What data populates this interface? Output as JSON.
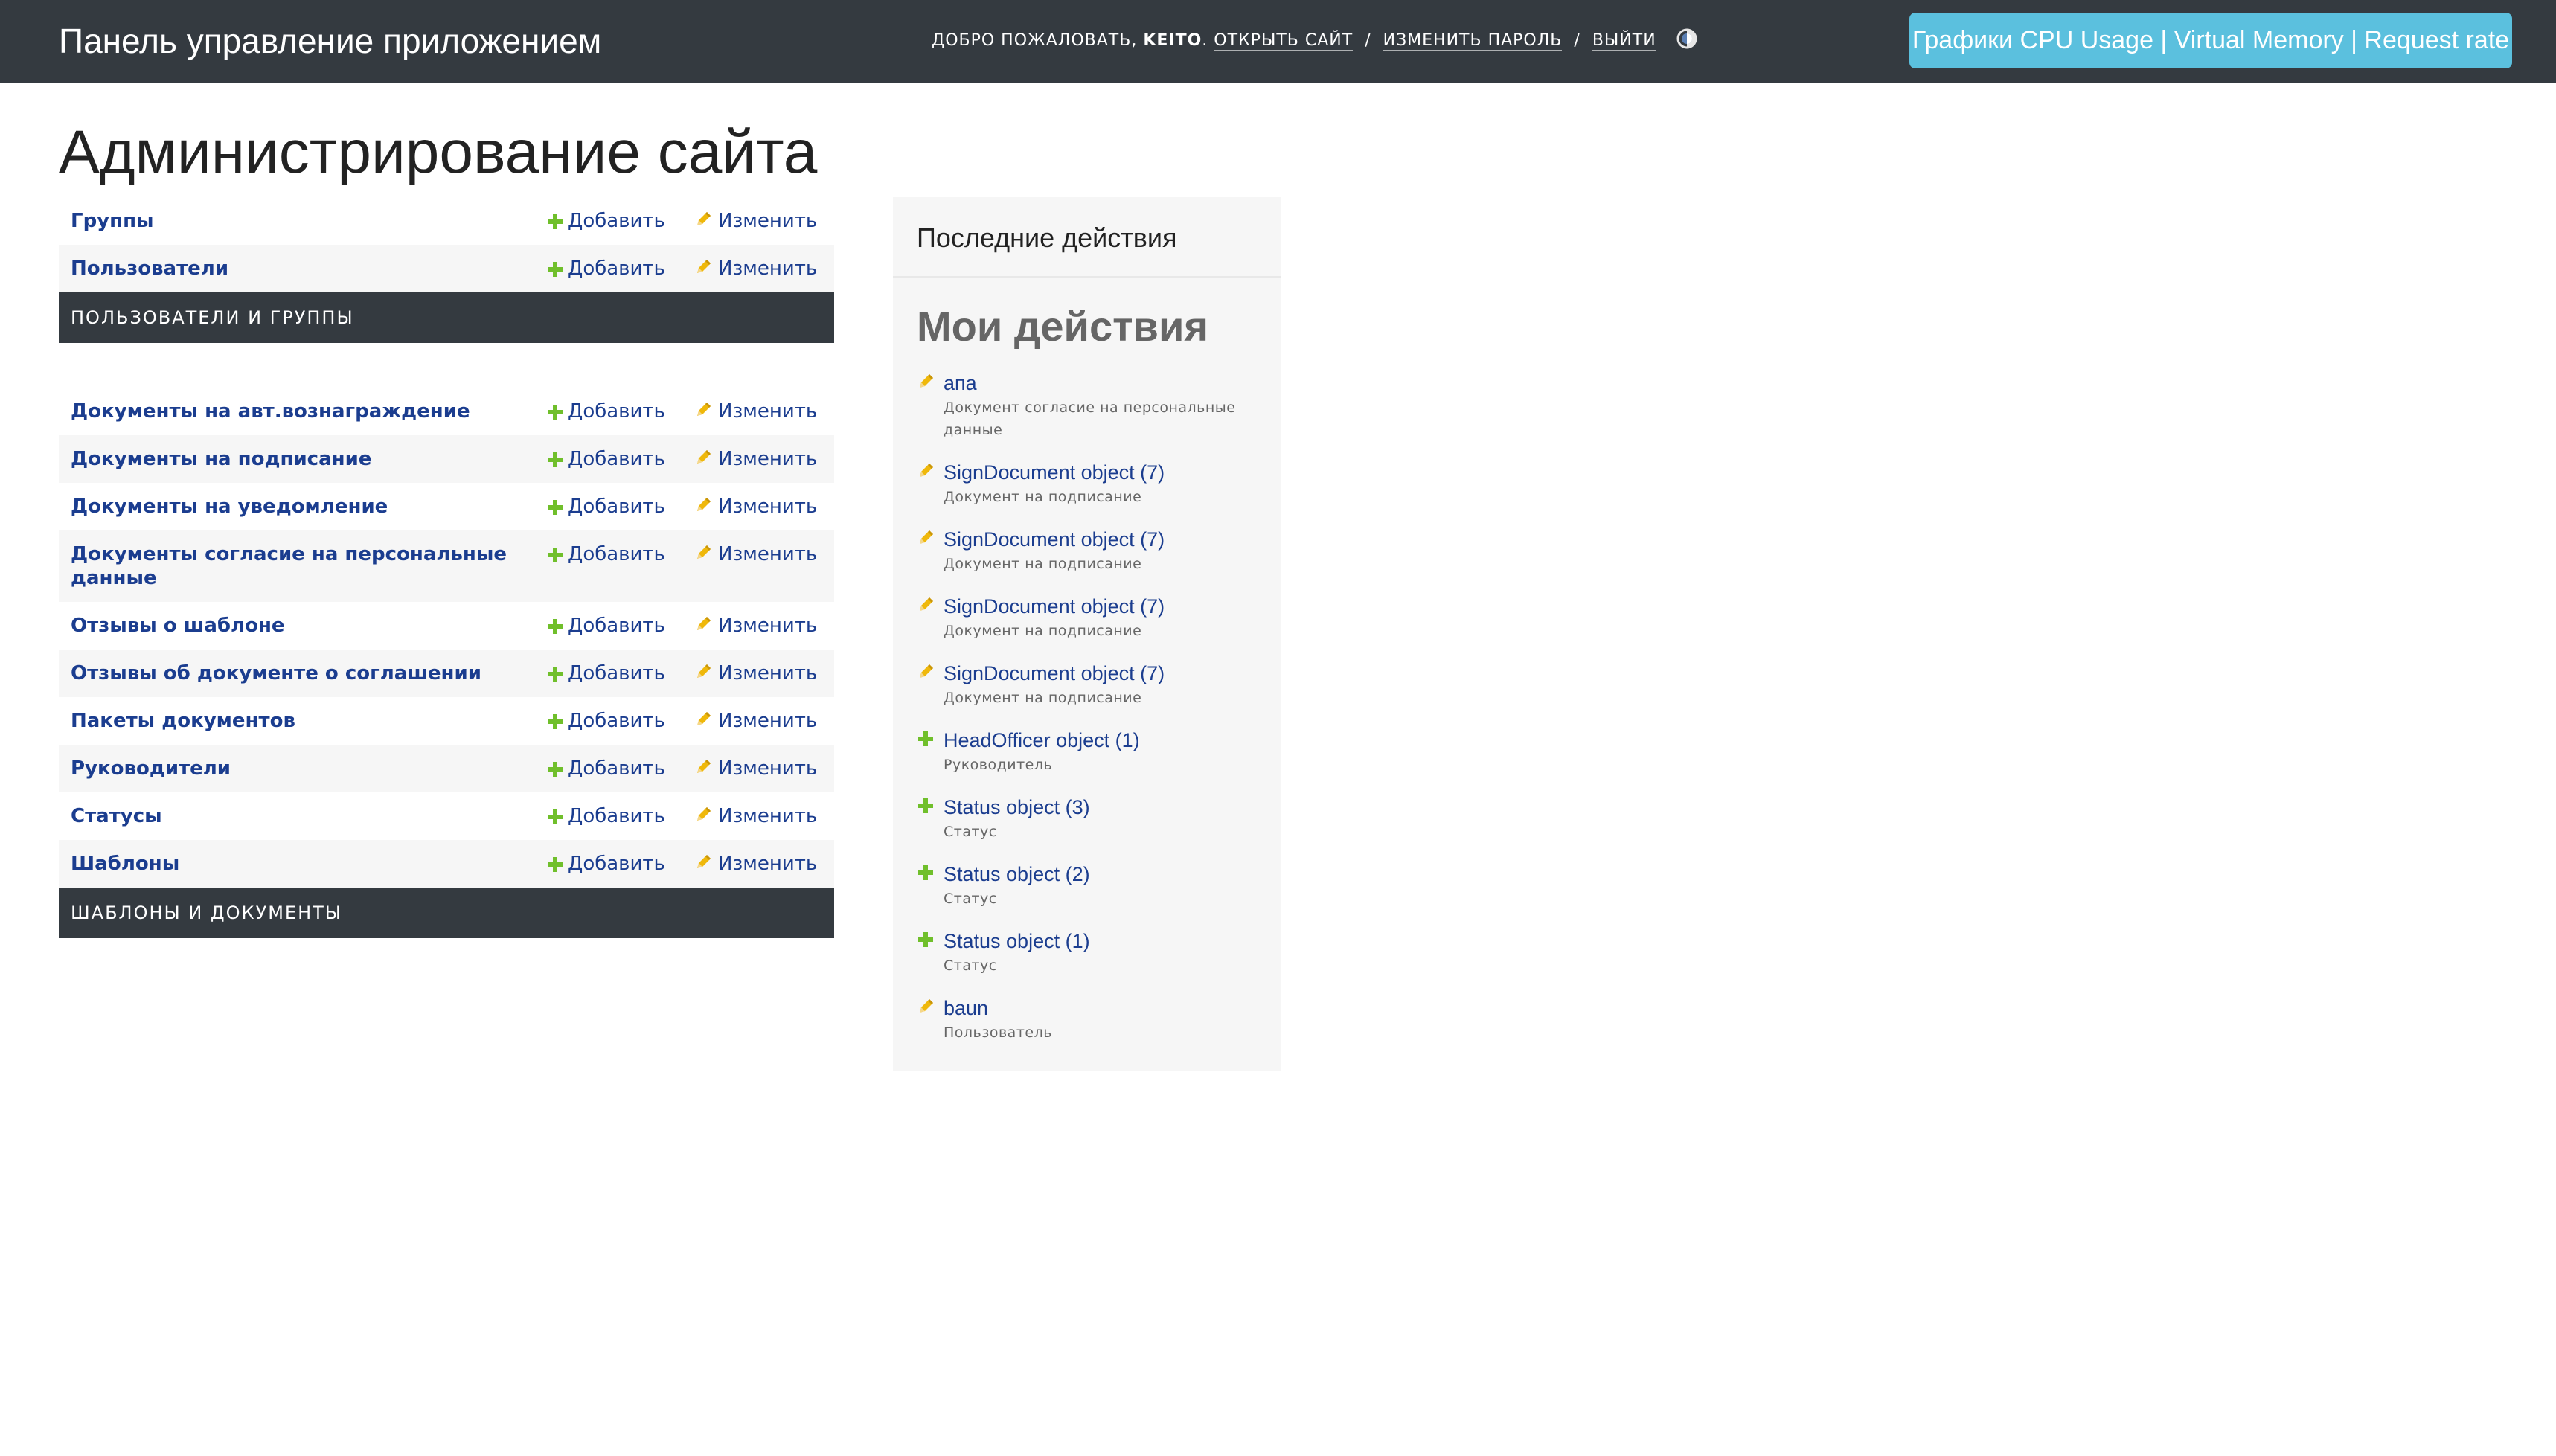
{
  "header": {
    "branding": "Панель управление приложением",
    "welcome": "Добро пожаловать, ",
    "username": "keito",
    "view_site": "Открыть сайт",
    "change_password": "Изменить пароль",
    "logout": "Выйти",
    "separator": "/",
    "charts_button": "Графики CPU Usage | Virtual Memory | Request rate"
  },
  "page_title": "Администрирование сайта",
  "labels": {
    "add": "Добавить",
    "change": "Изменить"
  },
  "apps": [
    {
      "caption": "Пользователи и группы",
      "models": [
        "Группы",
        "Пользователи"
      ]
    },
    {
      "caption": "Шаблоны и документы",
      "models": [
        "Документы на авт.вознаграждение",
        "Документы на подписание",
        "Документы на уведомление",
        "Документы согласие на персональные данные",
        "Отзывы о шаблоне",
        "Отзывы об документе о соглашении",
        "Пакеты документов",
        "Руководители",
        "Статусы",
        "Шаблоны"
      ]
    }
  ],
  "recent": {
    "title": "Последние действия",
    "subtitle": "Мои действия",
    "items": [
      {
        "icon": "pencil-icon",
        "name": "апа",
        "type": "Документ согласие на персональные данные"
      },
      {
        "icon": "pencil-icon",
        "name": "SignDocument object (7)",
        "type": "Документ на подписание"
      },
      {
        "icon": "pencil-icon",
        "name": "SignDocument object (7)",
        "type": "Документ на подписание"
      },
      {
        "icon": "pencil-icon",
        "name": "SignDocument object (7)",
        "type": "Документ на подписание"
      },
      {
        "icon": "pencil-icon",
        "name": "SignDocument object (7)",
        "type": "Документ на подписание"
      },
      {
        "icon": "plus-icon",
        "name": "HeadOfficer object (1)",
        "type": "Руководитель"
      },
      {
        "icon": "plus-icon",
        "name": "Status object (3)",
        "type": "Статус"
      },
      {
        "icon": "plus-icon",
        "name": "Status object (2)",
        "type": "Статус"
      },
      {
        "icon": "plus-icon",
        "name": "Status object (1)",
        "type": "Статус"
      },
      {
        "icon": "pencil-icon",
        "name": "baun",
        "type": "Пользователь"
      }
    ]
  },
  "colors": {
    "header_bg": "#343a40",
    "link": "#1b3d8f",
    "add_icon": "#70bf2b",
    "change_icon": "#efb80b",
    "charts_button_bg": "#5bc0de"
  }
}
